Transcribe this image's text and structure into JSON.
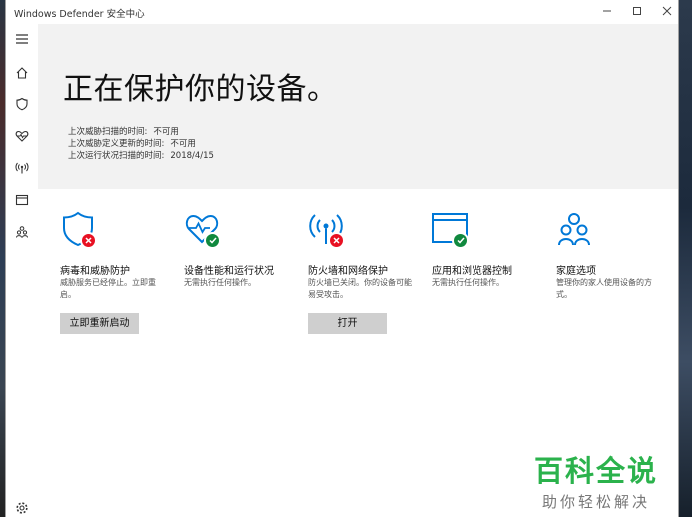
{
  "window": {
    "title": "Windows Defender 安全中心",
    "controls": [
      "minimize",
      "maximize",
      "close"
    ]
  },
  "sidebar": {
    "items": [
      {
        "icon": "menu-icon"
      },
      {
        "icon": "home-icon"
      },
      {
        "icon": "shield-icon"
      },
      {
        "icon": "heart-pulse-icon"
      },
      {
        "icon": "wifi-antenna-icon"
      },
      {
        "icon": "browser-window-icon"
      },
      {
        "icon": "family-icon"
      }
    ],
    "settings_icon": "gear-icon"
  },
  "hero": {
    "title": "正在保护你的设备。",
    "status": [
      {
        "label": "上次威胁扫描的时间:",
        "value": "不可用"
      },
      {
        "label": "上次威胁定义更新的时间:",
        "value": "不可用"
      },
      {
        "label": "上次运行状况扫描的时间:",
        "value": "2018/4/15"
      }
    ]
  },
  "tiles": [
    {
      "name": "病毒和威胁防护",
      "desc": "威胁服务已经停止。立即重启。",
      "button": "立即重新启动",
      "status": "error"
    },
    {
      "name": "设备性能和运行状况",
      "desc": "无需执行任何操作。",
      "status": "ok"
    },
    {
      "name": "防火墙和网络保护",
      "desc": "防火墙已关闭。你的设备可能易受攻击。",
      "button": "打开",
      "status": "error"
    },
    {
      "name": "应用和浏览器控制",
      "desc": "无需执行任何操作。",
      "status": "ok"
    },
    {
      "name": "家庭选项",
      "desc": "管理你的家人使用设备的方式。",
      "status": "none"
    }
  ],
  "watermark": {
    "big": "百科全说",
    "small": "助你轻松解决"
  },
  "colors": {
    "accent": "#0078d7",
    "error": "#e81123",
    "ok": "#10893e",
    "watermark": "#2bb24c"
  }
}
